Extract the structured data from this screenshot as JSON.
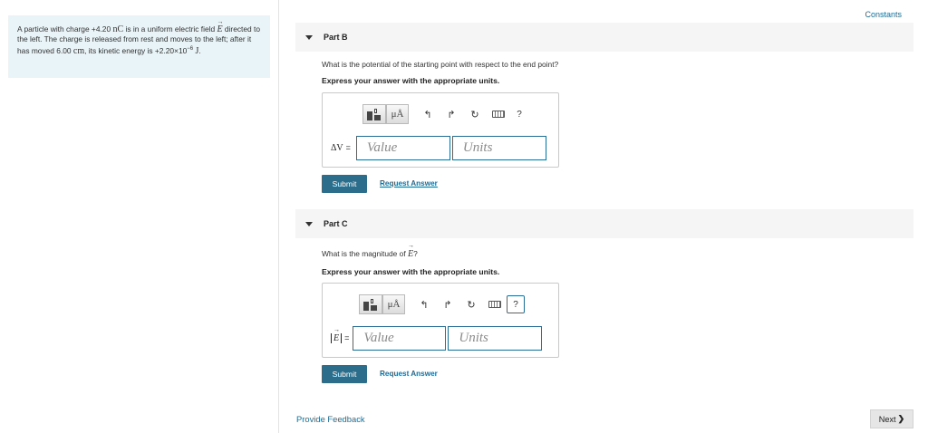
{
  "problem": {
    "t1": "A particle with charge +4.20 ",
    "charge_unit": "nC",
    "t2": " is in a uniform electric field ",
    "field_symbol": "E",
    "t3": " directed to the left. The charge is released from rest and moves to the left; after it has moved 6.00 ",
    "distance_unit": "cm",
    "t4": ", its kinetic energy is +2.20×10",
    "exponent": "−6",
    "t5": " ",
    "energy_unit": "J",
    "t6": "."
  },
  "header": {
    "constants_label": "Constants"
  },
  "part_b": {
    "title": "Part B",
    "question": "What is the potential of the starting point with respect to the end point?",
    "instruction": "Express your answer with the appropriate units.",
    "toolbar": {
      "mu_label": "μÅ",
      "help_label": "?"
    },
    "input_label": "ΔV",
    "equals": "=",
    "value_placeholder": "Value",
    "units_placeholder": "Units",
    "submit_label": "Submit",
    "request_label": "Request Answer"
  },
  "part_c": {
    "title": "Part C",
    "question_prefix": "What is the magnitude of ",
    "question_symbol": "E",
    "question_suffix": "?",
    "instruction": "Express your answer with the appropriate units.",
    "toolbar": {
      "mu_label": "μÅ",
      "help_label": "?"
    },
    "input_symbol": "E",
    "equals": "=",
    "value_placeholder": "Value",
    "units_placeholder": "Units",
    "submit_label": "Submit",
    "request_label": "Request Answer"
  },
  "footer": {
    "feedback_label": "Provide Feedback",
    "next_label": "Next",
    "next_chevron": "❯"
  },
  "colors": {
    "accent": "#2c6d8c",
    "link": "#1f6c96",
    "problem_bg": "#e9f4f8",
    "part_header_bg": "#f5f5f5"
  }
}
